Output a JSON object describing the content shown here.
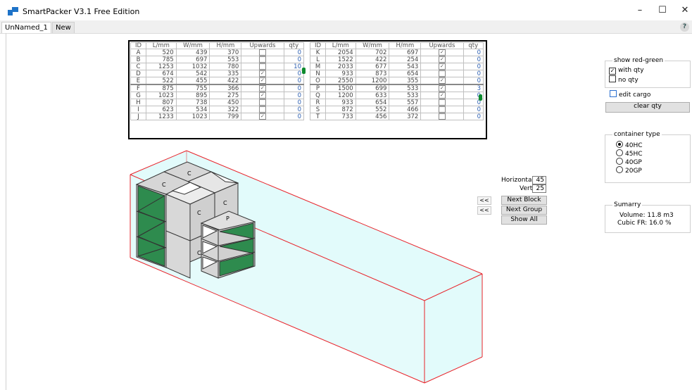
{
  "window": {
    "title": "SmartPacker V3.1 Free Edition",
    "minimize_glyph": "–",
    "maximize_glyph": "☐",
    "close_glyph": "✕"
  },
  "tabs": [
    {
      "label": "UnNamed_1"
    },
    {
      "label": "New"
    }
  ],
  "help_glyph": "?",
  "table": {
    "headers": [
      "ID",
      "L/mm",
      "W/mm",
      "H/mm",
      "Upwards",
      "qty"
    ],
    "left": [
      {
        "id": "A",
        "l": "520",
        "w": "439",
        "h": "370",
        "up": false,
        "qty": "0"
      },
      {
        "id": "B",
        "l": "785",
        "w": "697",
        "h": "553",
        "up": false,
        "qty": "0"
      },
      {
        "id": "C",
        "l": "1253",
        "w": "1032",
        "h": "780",
        "up": false,
        "qty": "10"
      },
      {
        "id": "D",
        "l": "674",
        "w": "542",
        "h": "335",
        "up": true,
        "qty": "0"
      },
      {
        "id": "E",
        "l": "522",
        "w": "455",
        "h": "422",
        "up": true,
        "qty": "0"
      },
      {
        "id": "F",
        "l": "875",
        "w": "755",
        "h": "366",
        "up": true,
        "qty": "0"
      },
      {
        "id": "G",
        "l": "1023",
        "w": "895",
        "h": "275",
        "up": true,
        "qty": "0"
      },
      {
        "id": "H",
        "l": "807",
        "w": "738",
        "h": "450",
        "up": false,
        "qty": "0"
      },
      {
        "id": "I",
        "l": "623",
        "w": "534",
        "h": "322",
        "up": false,
        "qty": "0"
      },
      {
        "id": "J",
        "l": "1233",
        "w": "1023",
        "h": "799",
        "up": true,
        "qty": "0"
      }
    ],
    "right": [
      {
        "id": "K",
        "l": "2054",
        "w": "702",
        "h": "697",
        "up": true,
        "qty": "0"
      },
      {
        "id": "L",
        "l": "1522",
        "w": "422",
        "h": "254",
        "up": true,
        "qty": "0"
      },
      {
        "id": "M",
        "l": "2033",
        "w": "677",
        "h": "543",
        "up": true,
        "qty": "0"
      },
      {
        "id": "N",
        "l": "933",
        "w": "873",
        "h": "654",
        "up": false,
        "qty": "0"
      },
      {
        "id": "O",
        "l": "2550",
        "w": "1200",
        "h": "355",
        "up": true,
        "qty": "0"
      },
      {
        "id": "P",
        "l": "1500",
        "w": "699",
        "h": "533",
        "up": true,
        "qty": "3"
      },
      {
        "id": "Q",
        "l": "1200",
        "w": "633",
        "h": "533",
        "up": true,
        "qty": "0"
      },
      {
        "id": "R",
        "l": "933",
        "w": "654",
        "h": "557",
        "up": false,
        "qty": "0"
      },
      {
        "id": "S",
        "l": "872",
        "w": "552",
        "h": "466",
        "up": false,
        "qty": "0"
      },
      {
        "id": "T",
        "l": "733",
        "w": "456",
        "h": "372",
        "up": false,
        "qty": "0"
      }
    ],
    "check_glyph": "✓"
  },
  "show_red_green": {
    "legend": "show red-green",
    "with_qty": {
      "label": "with qty",
      "checked": true
    },
    "no_qty": {
      "label": "no qty",
      "checked": false
    }
  },
  "edit_cargo": {
    "label": "edit cargo",
    "checked": false
  },
  "clear_qty_label": "clear qty",
  "container_type": {
    "legend": "container type",
    "options": [
      {
        "label": "40HC",
        "selected": true
      },
      {
        "label": "45HC",
        "selected": false
      },
      {
        "label": "40GP",
        "selected": false
      },
      {
        "label": "20GP",
        "selected": false
      }
    ]
  },
  "summary": {
    "legend": "Sumarry",
    "volume": "Volume:  11.8 m3",
    "cubic_fr": "Cubic FR:  16.0 %"
  },
  "view_controls": {
    "horizontal_label": "Horizontal",
    "horizontal_value": "45",
    "vertical_label": "Vertical",
    "vertical_value": "25",
    "back_glyph": "<<",
    "next_block": "Next Block",
    "next_group": "Next Group",
    "show_all": "Show All"
  },
  "scene": {
    "box_labels": [
      "C",
      "C",
      "C",
      "C",
      "P",
      "C"
    ],
    "colors": {
      "container": "#e8232a",
      "floor": "#e2fbfb",
      "box_face": "#d8d8d8",
      "green": "#2e8b4e"
    }
  }
}
